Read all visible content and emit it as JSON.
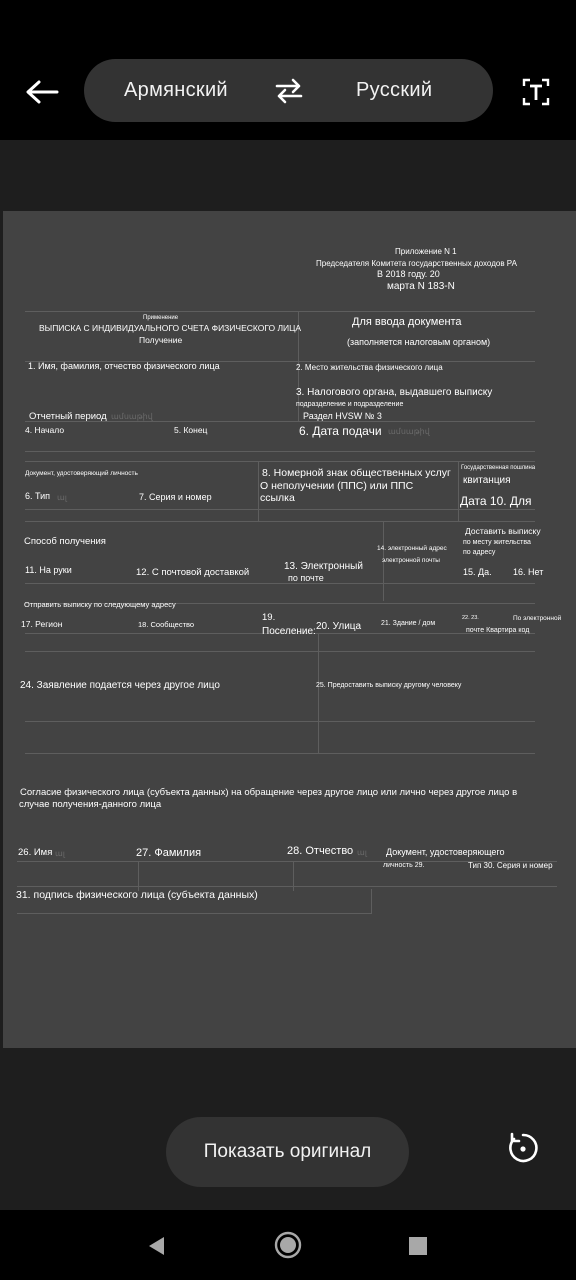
{
  "toolbar": {
    "source_language": "Армянский",
    "target_language": "Русский",
    "back_icon": "arrow-left-icon",
    "swap_icon": "swap-arrows-icon",
    "text_icon": "text-select-icon"
  },
  "document": {
    "header": {
      "line1": "Приложение N 1",
      "line2": "Председателя Комитета государственных доходов РА",
      "line3": "В 2018 году. 20",
      "line4": "марта N 183-N"
    },
    "note_small": "Применение",
    "title_line1": "ВЫПИСКА С ИНДИВИДУАЛЬНОГО СЧЕТА ФИЗИЧЕСКОГО ЛИЦА",
    "title_line2": "Получение",
    "for_input": "Для ввода документа",
    "for_input_sub": "(заполняется налоговым органом)",
    "f1": "1. Имя, фамилия, отчество физического лица",
    "f2": "2. Место жительства физического лица",
    "f3a": "3. Налогового органа, выдавшего выписку",
    "f3b": "подразделение и подразделение",
    "section": "Раздел HVSW № 3",
    "period": "Отчетный период",
    "f4": "4. Начало",
    "f5": "5. Конец",
    "f6": "6. Дата подачи",
    "id_doc": "Документ, удостоверяющий личность",
    "f8a": "8. Номерной знак общественных услуг",
    "f8b": "О неполучении (ППС) или ППС",
    "f8c": "ссылка",
    "state_fee": "Государственная пошлина",
    "receipt": "квитанция",
    "f6b": "6. Тип",
    "f7": "7. Серия и номер",
    "f9": "Дата 10. Для",
    "deliver1": "Доставить выписку",
    "deliver2": "по месту жительства",
    "deliver3": "по адресу",
    "method": "Способ получения",
    "f14a": "14. электронный адрес",
    "f14b": "электронной почты",
    "f11": "11. На руки",
    "f12": "12. С почтовой доставкой",
    "f13a": "13. Электронный",
    "f13b": "по почте",
    "f15": "15. Да.",
    "f16": "16. Нет",
    "send_to": "Отправить выписку по следующему адресу",
    "f17": "17. Регион",
    "f18": "18. Сообщество",
    "f19a": "19.",
    "f19b": "Поселение:",
    "f20": "20. Улица",
    "f21": "21. Здание / дом",
    "f22": "22. 23.",
    "f23a": "По электронной",
    "f23b": "почте Квартира код",
    "f24": "24. Заявление подается через другое лицо",
    "f25": "25. Предоставить выписку другому человеку",
    "consent1": "Согласие физического лица (субъекта данных) на обращение через другое лицо или лично через другое лицо в",
    "consent2": "случае получения-данного лица",
    "f26": "26. Имя",
    "f27": "27. Фамилия",
    "f28": "28. Отчество",
    "iddoc2a": "Документ, удостоверяющего",
    "iddoc2b": "личность 29.",
    "f30": "Тип 30. Серия и номер",
    "f31": "31. подпись физического лица (субъекта данных)",
    "ghost1": "ալ",
    "ghost2": "ամսաթիվ"
  },
  "show_original_label": "Показать оригинал",
  "refresh_icon": "refresh-icon",
  "nav": {
    "back_icon": "nav-back-icon",
    "home_icon": "nav-home-icon",
    "recent_icon": "nav-recents-icon"
  }
}
